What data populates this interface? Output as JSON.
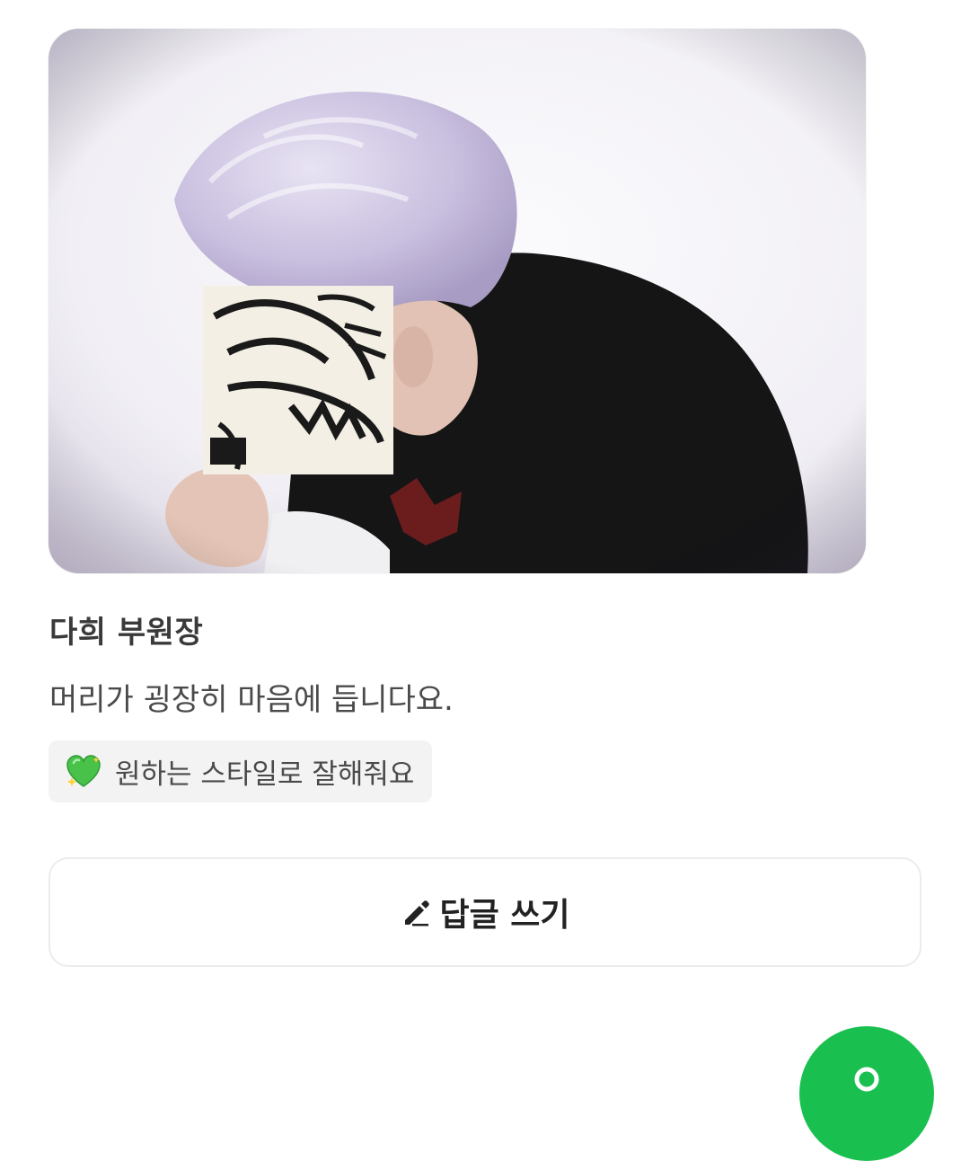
{
  "review": {
    "reviewer_name": "다희 부원장",
    "text": "머리가 굉장히 마음에 듭니다요.",
    "tag": {
      "icon": "sparkling-green-heart-icon",
      "label": "원하는 스타일로 잘해줘요"
    }
  },
  "actions": {
    "reply_label": "답글 쓰기",
    "reply_icon": "pencil-icon",
    "fab_icon": "chat-icon"
  },
  "colors": {
    "accent_green": "#19c04f",
    "chip_bg": "#f3f3f3",
    "heart_green": "#49c24a",
    "hair_lavender": "#cfc6e6"
  }
}
